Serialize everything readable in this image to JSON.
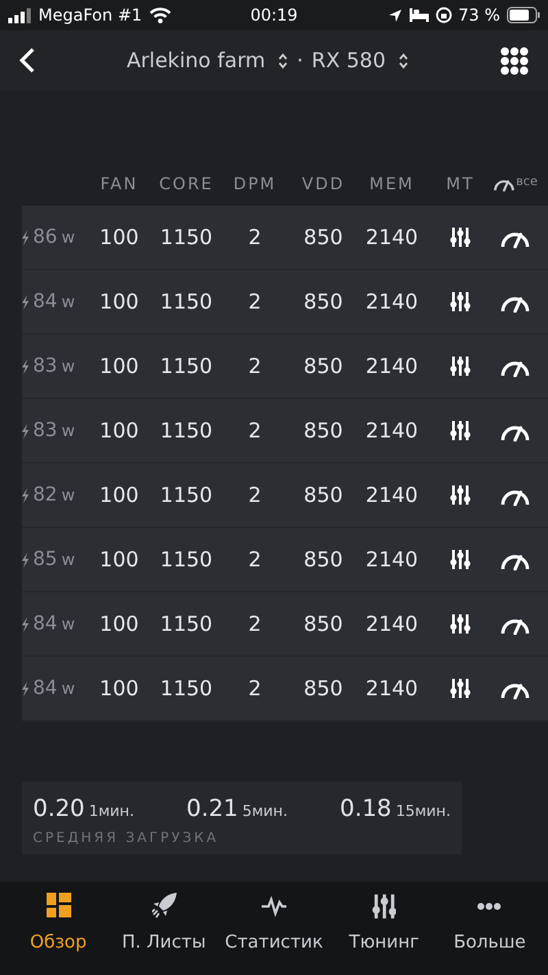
{
  "status_bar": {
    "carrier": "MegaFon #1",
    "time": "00:19",
    "battery": "73 %"
  },
  "nav": {
    "farm": "Arlekino farm",
    "separator": "·",
    "gpu": "RX 580"
  },
  "table": {
    "columns": [
      "FAN",
      "CORE",
      "DPM",
      "VDD",
      "MEM",
      "MT"
    ],
    "all_label": "все",
    "rows": [
      {
        "power": "86",
        "unit": "w",
        "fan": "100",
        "core": "1150",
        "dpm": "2",
        "vdd": "850",
        "mem": "2140"
      },
      {
        "power": "84",
        "unit": "w",
        "fan": "100",
        "core": "1150",
        "dpm": "2",
        "vdd": "850",
        "mem": "2140"
      },
      {
        "power": "83",
        "unit": "w",
        "fan": "100",
        "core": "1150",
        "dpm": "2",
        "vdd": "850",
        "mem": "2140"
      },
      {
        "power": "83",
        "unit": "w",
        "fan": "100",
        "core": "1150",
        "dpm": "2",
        "vdd": "850",
        "mem": "2140"
      },
      {
        "power": "82",
        "unit": "w",
        "fan": "100",
        "core": "1150",
        "dpm": "2",
        "vdd": "850",
        "mem": "2140"
      },
      {
        "power": "85",
        "unit": "w",
        "fan": "100",
        "core": "1150",
        "dpm": "2",
        "vdd": "850",
        "mem": "2140"
      },
      {
        "power": "84",
        "unit": "w",
        "fan": "100",
        "core": "1150",
        "dpm": "2",
        "vdd": "850",
        "mem": "2140"
      },
      {
        "power": "84",
        "unit": "w",
        "fan": "100",
        "core": "1150",
        "dpm": "2",
        "vdd": "850",
        "mem": "2140"
      }
    ]
  },
  "load_average": {
    "items": [
      {
        "value": "0.20",
        "period": "1мин."
      },
      {
        "value": "0.21",
        "period": "5мин."
      },
      {
        "value": "0.18",
        "period": "15мин."
      }
    ],
    "caption": "СРЕДНЯЯ ЗАГРУЗКА"
  },
  "tab_bar": [
    {
      "label": "Обзор",
      "kind": "grid",
      "selected": true
    },
    {
      "label": "П. Листы",
      "kind": "rocket",
      "selected": false
    },
    {
      "label": "Статистик",
      "kind": "pulse",
      "selected": false
    },
    {
      "label": "Тюнинг",
      "kind": "sliders",
      "selected": false
    },
    {
      "label": "Больше",
      "kind": "dots",
      "selected": false
    }
  ]
}
